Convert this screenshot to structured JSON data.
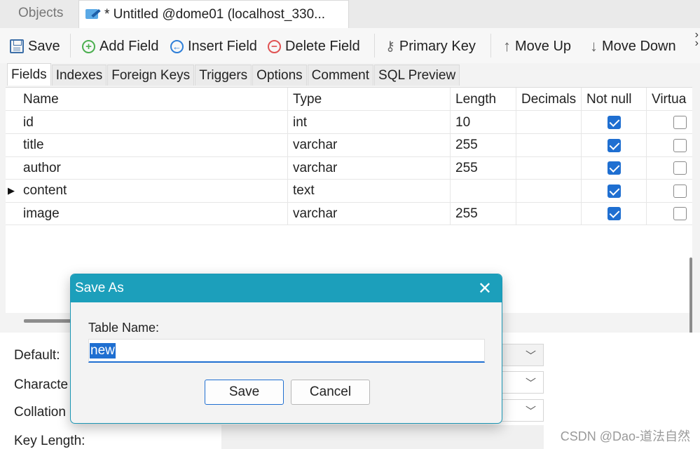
{
  "tabs": {
    "objects": "Objects",
    "untitled": "* Untitled @dome01 (localhost_330..."
  },
  "toolbar": {
    "save": "Save",
    "add_field": "Add Field",
    "insert_field": "Insert Field",
    "delete_field": "Delete Field",
    "primary_key": "Primary Key",
    "move_up": "Move Up",
    "move_down": "Move Down"
  },
  "subtabs": [
    "Fields",
    "Indexes",
    "Foreign Keys",
    "Triggers",
    "Options",
    "Comment",
    "SQL Preview"
  ],
  "grid": {
    "columns": [
      "Name",
      "Type",
      "Length",
      "Decimals",
      "Not null",
      "Virtua"
    ],
    "rows": [
      {
        "name": "id",
        "type": "int",
        "length": "10",
        "decimals": "",
        "not_null": true,
        "virtual": false
      },
      {
        "name": "title",
        "type": "varchar",
        "length": "255",
        "decimals": "",
        "not_null": true,
        "virtual": false
      },
      {
        "name": "author",
        "type": "varchar",
        "length": "255",
        "decimals": "",
        "not_null": true,
        "virtual": false
      },
      {
        "name": "content",
        "type": "text",
        "length": "",
        "decimals": "",
        "not_null": true,
        "virtual": false
      },
      {
        "name": "image",
        "type": "varchar",
        "length": "255",
        "decimals": "",
        "not_null": true,
        "virtual": false
      }
    ],
    "current_row": 3
  },
  "props": {
    "default": "Default:",
    "character": "Characte",
    "collation": "Collation",
    "key_length": "Key Length:"
  },
  "dialog": {
    "title": "Save As",
    "label": "Table Name:",
    "value": "new",
    "save": "Save",
    "cancel": "Cancel"
  },
  "watermark": "CSDN @Dao-道法自然",
  "colors": {
    "accent": "#1c9fbb",
    "checkbox": "#1f6fd1"
  }
}
